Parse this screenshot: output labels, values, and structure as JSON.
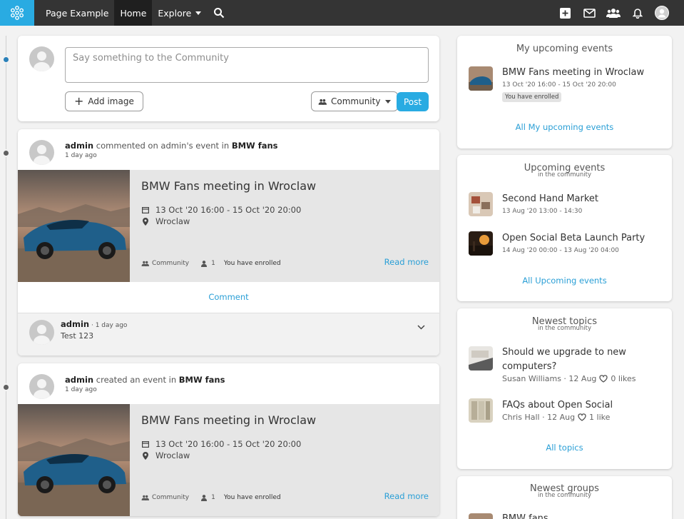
{
  "nav": {
    "site_name": "Page Example",
    "home": "Home",
    "explore": "Explore",
    "icons": [
      "snowflake-logo-icon",
      "search-icon",
      "plus-square-icon",
      "mail-icon",
      "users-icon",
      "bell-icon",
      "avatar-icon"
    ]
  },
  "composer": {
    "placeholder": "Say something to the Community",
    "add_image": "Add image",
    "visibility": "Community",
    "post": "Post"
  },
  "stream": [
    {
      "actor": "admin",
      "action_pre": " commented on admin's event in ",
      "group": "BMW fans",
      "time": "1 day ago",
      "event": {
        "title": "BMW Fans meeting in Wroclaw",
        "date": "13 Oct '20 16:00 - 15 Oct '20 20:00",
        "location": "Wroclaw",
        "visibility": "Community",
        "enrolled_count": "1",
        "enrolled_status": "You have enrolled",
        "read_more": "Read more"
      },
      "comment_link": "Comment",
      "comment": {
        "author": "admin",
        "time": " · 1 day ago",
        "text": "Test 123"
      }
    },
    {
      "actor": "admin",
      "action_pre": " created an event in ",
      "group": "BMW fans",
      "time": "1 day ago",
      "event": {
        "title": "BMW Fans meeting in Wroclaw",
        "date": "13 Oct '20 16:00 - 15 Oct '20 20:00",
        "location": "Wroclaw",
        "visibility": "Community",
        "enrolled_count": "1",
        "enrolled_status": "You have enrolled",
        "read_more": "Read more"
      }
    }
  ],
  "sidebar": {
    "my_events": {
      "title": "My upcoming events",
      "items": [
        {
          "title": "BMW Fans meeting in Wroclaw",
          "meta": "13 Oct '20 16:00 - 15 Oct '20 20:00",
          "badge": "You have enrolled"
        }
      ],
      "link": "All My upcoming events"
    },
    "upcoming_events": {
      "title": "Upcoming events",
      "subtitle": "in the community",
      "items": [
        {
          "title": "Second Hand Market",
          "meta": "13 Aug '20 13:00 - 14:30"
        },
        {
          "title": "Open Social Beta Launch Party",
          "meta": "14 Aug '20 00:00 - 13 Aug '20 04:00"
        }
      ],
      "link": "All Upcoming events"
    },
    "newest_topics": {
      "title": "Newest topics",
      "subtitle": "in the community",
      "items": [
        {
          "title_line1": "Should we upgrade to new",
          "title_line2": "computers?",
          "author": "Susan Williams · 12 Aug",
          "likes": "0 likes"
        },
        {
          "title_line1": "FAQs about Open Social",
          "author": "Chris Hall · 12 Aug",
          "likes": "1 like"
        }
      ],
      "link": "All topics"
    },
    "newest_groups": {
      "title": "Newest groups",
      "subtitle": "in the community",
      "items": [
        {
          "title": "BMW fans"
        }
      ]
    }
  },
  "colors": {
    "accent": "#29abe2",
    "link": "#2a9fd6",
    "navbar": "#343434"
  }
}
